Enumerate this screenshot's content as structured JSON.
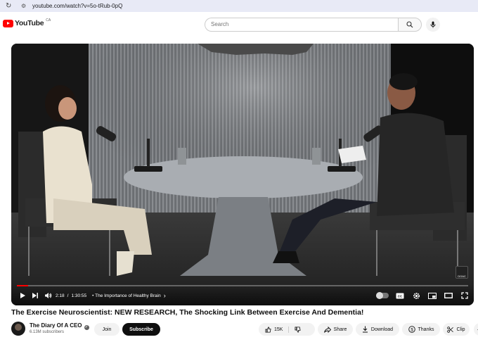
{
  "browser": {
    "url": "youtube.com/watch?v=5o-tRub-0pQ"
  },
  "header": {
    "logo_text": "YouTube",
    "country_code": "CA",
    "search_placeholder": "Search"
  },
  "player": {
    "current_time": "2:18",
    "duration": "1:30:55",
    "chapter": "• The Importance of Healthy Brain",
    "chapter_chevron": "›",
    "progress": 0.025,
    "watermark": "DOAC"
  },
  "video": {
    "title": "The Exercise Neuroscientist: NEW RESEARCH, The Shocking Link Between Exercise And Dementia!"
  },
  "channel": {
    "name": "The Diary Of A CEO",
    "subscribers": "6.13M subscribers",
    "join_label": "Join",
    "subscribe_label": "Subscribe"
  },
  "actions": {
    "likes": "15K",
    "share": "Share",
    "download": "Download",
    "thanks": "Thanks",
    "clip": "Clip"
  }
}
